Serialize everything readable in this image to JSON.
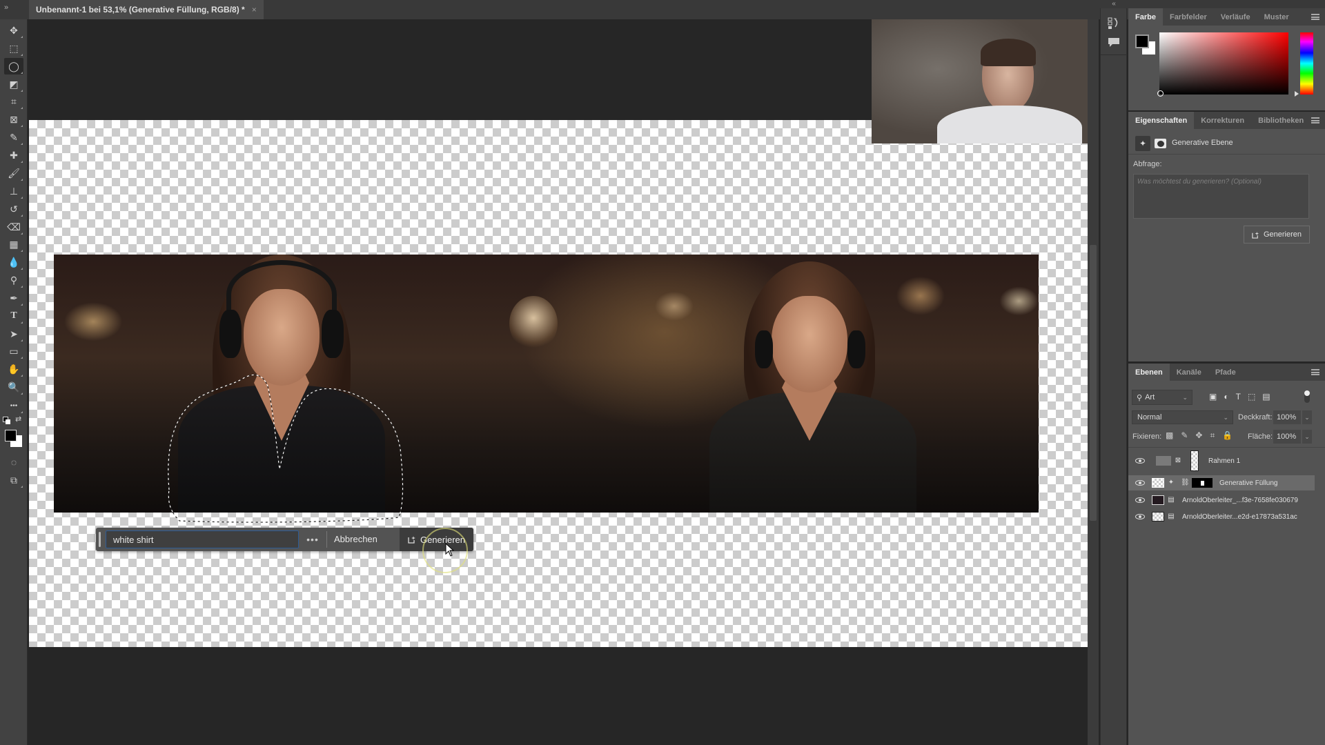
{
  "app": {
    "document_tab": {
      "title": "Unbenannt-1 bei 53,1% (Generative Füllung, RGB/8) *",
      "close_glyph": "×"
    },
    "collapse_left": "»",
    "collapse_right": "«"
  },
  "toolbar": {
    "tools": [
      {
        "name": "move-tool",
        "glyph": "✥"
      },
      {
        "name": "marquee-tool",
        "glyph": "⬚"
      },
      {
        "name": "lasso-tool",
        "glyph": "◯",
        "active": true
      },
      {
        "name": "object-selection-tool",
        "glyph": "◩"
      },
      {
        "name": "crop-tool",
        "glyph": "⌗"
      },
      {
        "name": "frame-tool",
        "glyph": "⊠"
      },
      {
        "name": "eyedropper-tool",
        "glyph": "✎"
      },
      {
        "name": "healing-brush-tool",
        "glyph": "✚"
      },
      {
        "name": "brush-tool",
        "glyph": "🖌"
      },
      {
        "name": "clone-stamp-tool",
        "glyph": "⊥"
      },
      {
        "name": "history-brush-tool",
        "glyph": "↺"
      },
      {
        "name": "eraser-tool",
        "glyph": "⌫"
      },
      {
        "name": "gradient-tool",
        "glyph": "▦"
      },
      {
        "name": "blur-tool",
        "glyph": "💧"
      },
      {
        "name": "dodge-tool",
        "glyph": "⚲"
      },
      {
        "name": "pen-tool",
        "glyph": "✒"
      },
      {
        "name": "type-tool",
        "glyph": "T"
      },
      {
        "name": "path-selection-tool",
        "glyph": "➤"
      },
      {
        "name": "rectangle-tool",
        "glyph": "▭"
      },
      {
        "name": "hand-tool",
        "glyph": "✋"
      },
      {
        "name": "zoom-tool",
        "glyph": "🔍"
      },
      {
        "name": "edit-toolbar",
        "glyph": "•••"
      }
    ],
    "swap_glyph": "⇄",
    "quick_mask_glyph": "◌",
    "screen_mode_glyph": "⧉"
  },
  "canvas": {
    "checker_light": "#ffffff",
    "checker_dark": "#cccccc"
  },
  "taskbar": {
    "prompt_value": "white shirt",
    "more_label": "•••",
    "cancel_label": "Abbrechen",
    "generate_label": "Generieren"
  },
  "color_panel": {
    "tabs": [
      "Farbe",
      "Farbfelder",
      "Verläufe",
      "Muster"
    ],
    "active_tab": 0,
    "foreground": "#000000",
    "background": "#ffffff",
    "hue": "#ff0000"
  },
  "properties_panel": {
    "tabs": [
      "Eigenschaften",
      "Korrekturen",
      "Bibliotheken"
    ],
    "active_tab": 0,
    "layer_type": "Generative Ebene",
    "query_label": "Abfrage:",
    "query_placeholder": "Was möchtest du generieren? (Optional)",
    "generate_label": "Generieren"
  },
  "layers_panel": {
    "tabs": [
      "Ebenen",
      "Kanäle",
      "Pfade"
    ],
    "active_tab": 0,
    "filter_label": "Art",
    "blend_mode": "Normal",
    "opacity_label": "Deckkraft:",
    "opacity_value": "100%",
    "lock_label": "Fixieren:",
    "fill_label": "Fläche:",
    "fill_value": "100%",
    "layers": [
      {
        "name": "Rahmen 1",
        "visible": true,
        "selected": false,
        "type": "frame"
      },
      {
        "name": "Generative Füllung",
        "visible": true,
        "selected": true,
        "type": "generative"
      },
      {
        "name": "ArnoldOberleiter_...f3e-7658fe030679",
        "visible": true,
        "selected": false,
        "type": "smart"
      },
      {
        "name": "ArnoldOberleiter...e2d-e17873a531ac",
        "visible": true,
        "selected": false,
        "type": "smart"
      }
    ]
  }
}
